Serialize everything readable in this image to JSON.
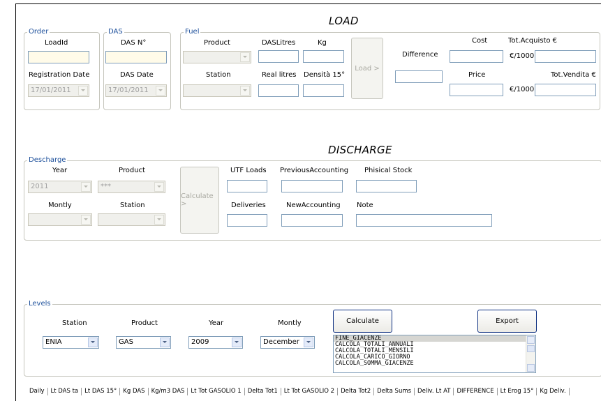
{
  "load": {
    "title": "LOAD",
    "order": {
      "legend": "Order",
      "load_id_label": "LoadId",
      "registration_date_label": "Registration Date",
      "registration_date_value": "17/01/2011"
    },
    "das": {
      "legend": "DAS",
      "das_no_label": "DAS N°",
      "das_date_label": "DAS Date",
      "das_date_value": "17/01/2011"
    },
    "fuel": {
      "legend": "Fuel",
      "product_label": "Product",
      "station_label": "Station",
      "das_litres_label": "DASLitres",
      "kg_label": "Kg",
      "real_litres_label": "Real litres",
      "densita_label": "Densità 15°",
      "load_button": "Load >"
    },
    "difference_label": "Difference",
    "cost_label": "Cost",
    "tot_acquisto_label": "Tot.Acquisto €",
    "price_label": "Price",
    "tot_vendita_label": "Tot.Vendita €",
    "unit_cost": "€/1000l",
    "unit_price": "€/1000l"
  },
  "discharge": {
    "title": "DISCHARGE",
    "legend": "Descharge",
    "year_label": "Year",
    "year_value": "2011",
    "product_label": "Product",
    "product_value": "***",
    "montly_label": "Montly",
    "station_label": "Station",
    "calculate_button": "Calculate >",
    "utf_loads_label": "UTF Loads",
    "previous_accounting_label": "PreviousAccounting",
    "phisical_stock_label": "Phisical Stock",
    "deliveries_label": "Deliveries",
    "new_accounting_label": "NewAccounting",
    "note_label": "Note"
  },
  "levels": {
    "legend": "Levels",
    "station_label": "Station",
    "station_value": "ENIA",
    "product_label": "Product",
    "product_value": "GAS",
    "year_label": "Year",
    "year_value": "2009",
    "montly_label": "Montly",
    "montly_value": "December",
    "calculate_button": "Calculate",
    "export_button": "Export",
    "procedures": [
      "FINE_GIACENZE",
      "CALCOLA_TOTALI_ANNUALI",
      "CALCOLA_TOTALI_MENSILI",
      "CALCOLA_CARICO_GIORNO",
      "CALCOLA_SOMMA_GIACENZE"
    ]
  },
  "status_columns": [
    "Daily",
    "Lt DAS ta",
    "Lt DAS 15°",
    "Kg DAS",
    "Kg/m3 DAS",
    "Lt Tot GASOLIO 1",
    "Delta Tot1",
    "Lt Tot GASOLIO 2",
    "Delta Tot2",
    "Delta Sums",
    "Deliv. Lt AT",
    "DIFFERENCE",
    "Lt Erog 15°",
    "Kg Deliv."
  ]
}
